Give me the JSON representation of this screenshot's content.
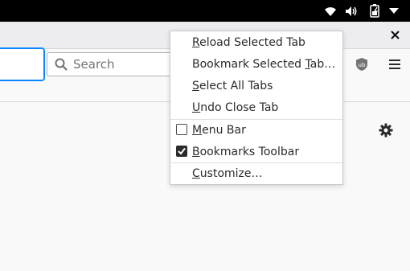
{
  "system_tray": {
    "icons": [
      "wifi-icon",
      "volume-icon",
      "battery-charging-icon",
      "chevron-down-icon"
    ]
  },
  "search": {
    "placeholder": "Search"
  },
  "toolbar": {
    "icons": [
      "ublock-origin-icon",
      "hamburger-menu-icon",
      "settings-gear-icon",
      "close-icon"
    ]
  },
  "context_menu": {
    "items": [
      {
        "label": "Reload Selected Tab",
        "accesskey": "R"
      },
      {
        "label": "Bookmark Selected Tab…",
        "accesskey": "T"
      },
      {
        "label": "Select All Tabs",
        "accesskey": "S"
      },
      {
        "label": "Undo Close Tab",
        "accesskey": "U"
      },
      {
        "label": "Menu Bar",
        "accesskey": "M",
        "checked": false
      },
      {
        "label": "Bookmarks Toolbar",
        "accesskey": "B",
        "checked": true
      },
      {
        "label": "Customize…",
        "accesskey": "C"
      }
    ]
  },
  "colors": {
    "accent": "#0a84ff",
    "tabstrip": "#ededf0",
    "toolbar": "#f9f9fa",
    "topbar": "#000000"
  }
}
